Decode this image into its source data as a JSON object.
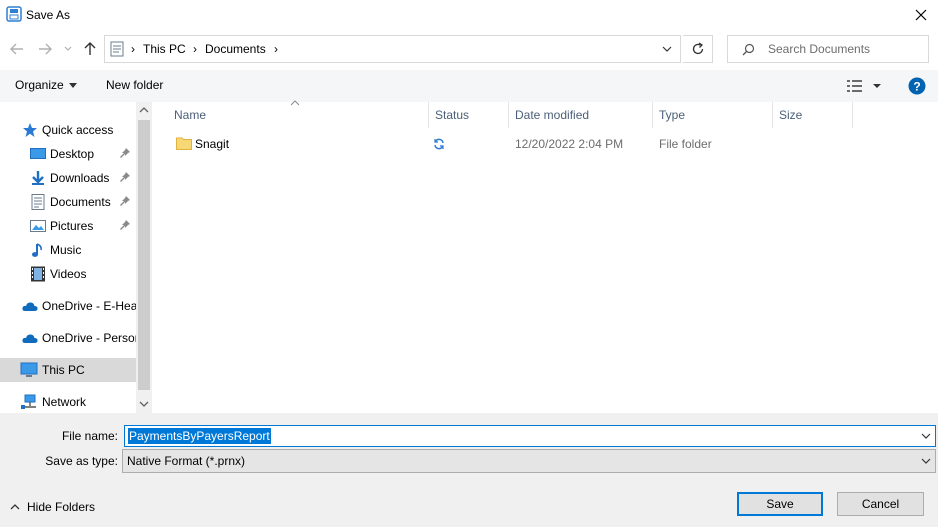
{
  "window": {
    "title": "Save As"
  },
  "nav": {
    "breadcrumb": [
      "This PC",
      "Documents"
    ],
    "search_placeholder": "Search Documents"
  },
  "toolbar": {
    "organize": "Organize",
    "new_folder": "New folder"
  },
  "sidebar": {
    "items": [
      {
        "label": "Quick access",
        "icon": "star-icon"
      },
      {
        "label": "Desktop",
        "icon": "desktop-icon",
        "pinned": true
      },
      {
        "label": "Downloads",
        "icon": "download-icon",
        "pinned": true
      },
      {
        "label": "Documents",
        "icon": "document-icon",
        "pinned": true
      },
      {
        "label": "Pictures",
        "icon": "picture-icon",
        "pinned": true
      },
      {
        "label": "Music",
        "icon": "music-icon"
      },
      {
        "label": "Videos",
        "icon": "video-icon"
      },
      {
        "label": "OneDrive - E-Heal",
        "icon": "cloud-icon"
      },
      {
        "label": "OneDrive - Persor",
        "icon": "cloud-icon"
      },
      {
        "label": "This PC",
        "icon": "computer-icon",
        "selected": true
      },
      {
        "label": "Network",
        "icon": "network-icon"
      }
    ]
  },
  "file_list": {
    "columns": [
      "Name",
      "Status",
      "Date modified",
      "Type",
      "Size"
    ],
    "rows": [
      {
        "name": "Snagit",
        "status": "sync-icon",
        "date_modified": "12/20/2022 2:04 PM",
        "type": "File folder",
        "size": ""
      }
    ]
  },
  "save_form": {
    "file_name_label": "File name:",
    "file_name_value": "PaymentsByPayersReport",
    "save_as_type_label": "Save as type:",
    "save_as_type_value": "Native Format (*.prnx)",
    "save_label": "Save",
    "cancel_label": "Cancel",
    "hide_folders_label": "Hide Folders"
  },
  "colors": {
    "accent": "#0078d7",
    "help": "#0063b1",
    "folder": "#f8d775"
  }
}
